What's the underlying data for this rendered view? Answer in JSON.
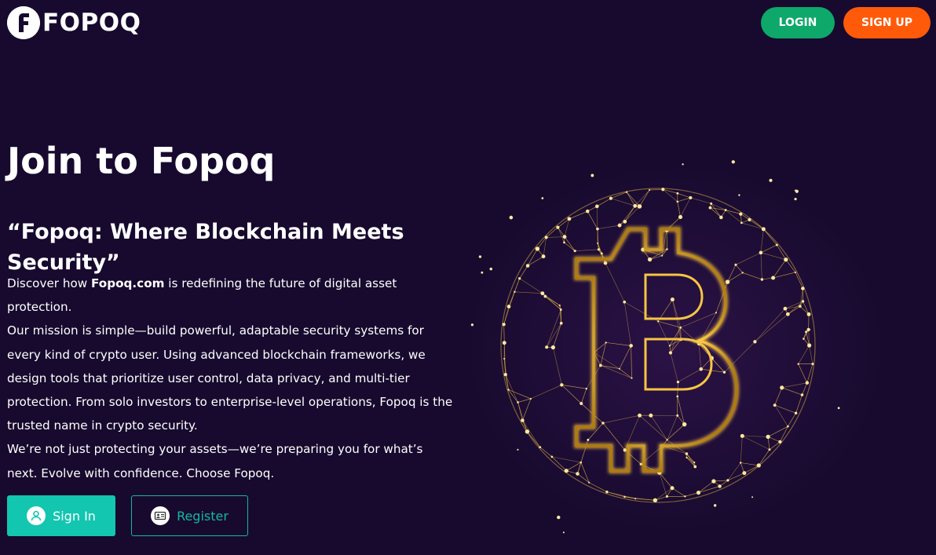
{
  "header": {
    "logo_letter": "F",
    "logo_text": "FOPOQ",
    "login_label": "LOGIN",
    "signup_label": "SIGN UP"
  },
  "hero": {
    "title": "Join to Fopoq",
    "subtitle": "“Fopoq: Where Blockchain Meets Security”",
    "intro_before": "Discover how ",
    "intro_link": "Fopoq.com",
    "intro_after": " is redefining the future of digital asset protection.",
    "mission": "Our mission is simple—build powerful, adaptable security systems for every kind of crypto user. Using advanced blockchain frameworks, we design tools that prioritize user control, data privacy, and multi-tier protection. From solo investors to enterprise-level operations, Fopoq is the trusted name in crypto security.",
    "closing": "We’re not just protecting your assets—we’re preparing you for what’s next. Evolve with confidence. Choose Fopoq."
  },
  "cta": {
    "signin_label": "Sign In",
    "register_label": "Register",
    "signin_icon": "user-icon",
    "register_icon": "id-card-icon"
  },
  "colors": {
    "background": "#170a2e",
    "login_green": "#0ea86a",
    "signup_orange": "#ff5a0a",
    "teal": "#13c6b0",
    "gold": "#f5c542"
  }
}
